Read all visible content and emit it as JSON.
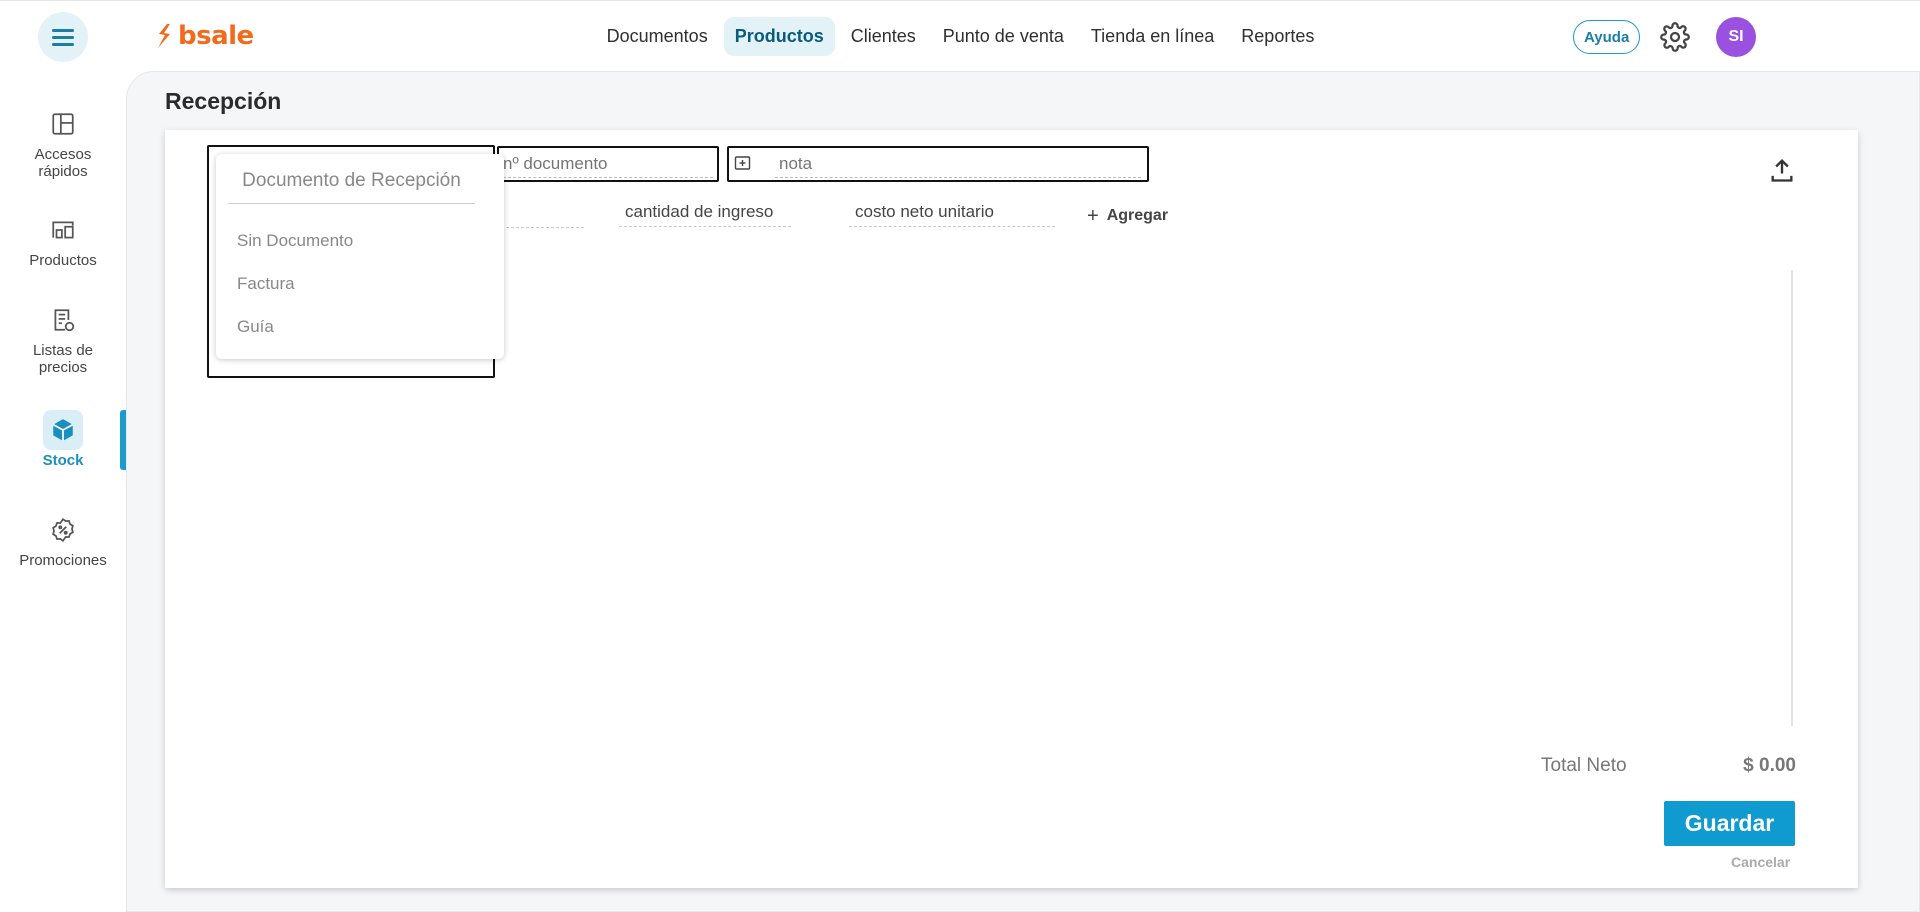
{
  "header": {
    "logo_text": "bsale",
    "nav": [
      "Documentos",
      "Productos",
      "Clientes",
      "Punto de venta",
      "Tienda en línea",
      "Reportes"
    ],
    "active_nav": "Productos",
    "help_label": "Ayuda",
    "avatar_initials": "SI"
  },
  "sidebar": {
    "items": [
      {
        "label": "Accesos rápidos",
        "icon": "layout-icon"
      },
      {
        "label": "Productos",
        "icon": "products-icon"
      },
      {
        "label": "Listas de precios",
        "icon": "price-list-icon"
      },
      {
        "label": "Stock",
        "icon": "box-icon"
      },
      {
        "label": "Promociones",
        "icon": "discount-icon"
      }
    ],
    "active": "Stock"
  },
  "page": {
    "title": "Recepción"
  },
  "form": {
    "doc_number_placeholder": "nº documento",
    "note_placeholder": "nota",
    "quantity_placeholder": "cantidad de ingreso",
    "unit_cost_placeholder": "costo neto unitario",
    "add_label": "Agregar"
  },
  "dropdown": {
    "header": "Documento de Recepción",
    "options": [
      "Sin Documento",
      "Factura",
      "Guía"
    ]
  },
  "footer": {
    "total_label": "Total Neto",
    "total_value": "$ 0.00",
    "save_label": "Guardar",
    "cancel_label": "Cancelar"
  },
  "colors": {
    "brand": "#f26a1b",
    "accent": "#0f9bcf",
    "avatar": "#9b51e0"
  }
}
